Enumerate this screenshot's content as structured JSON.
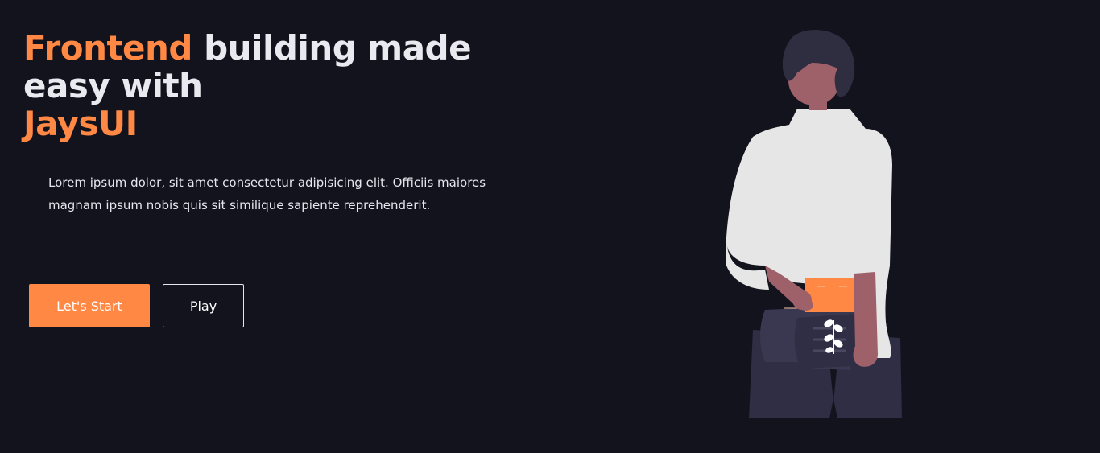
{
  "hero": {
    "title_part1": "Frontend",
    "title_part2": " building made easy with",
    "title_part3": "JaysUI",
    "description": "Lorem ipsum dolor, sit amet consectetur adipisicing elit. Officiis maiores magnam ipsum nobis quis sit similique sapiente reprehenderit.",
    "start_label": "Let's Start",
    "play_label": "Play"
  },
  "colors": {
    "background": "#13131d",
    "accent": "#ff8844",
    "text": "#e8eaf0"
  },
  "illustration": {
    "icon": "person-holding-box-illustration"
  }
}
